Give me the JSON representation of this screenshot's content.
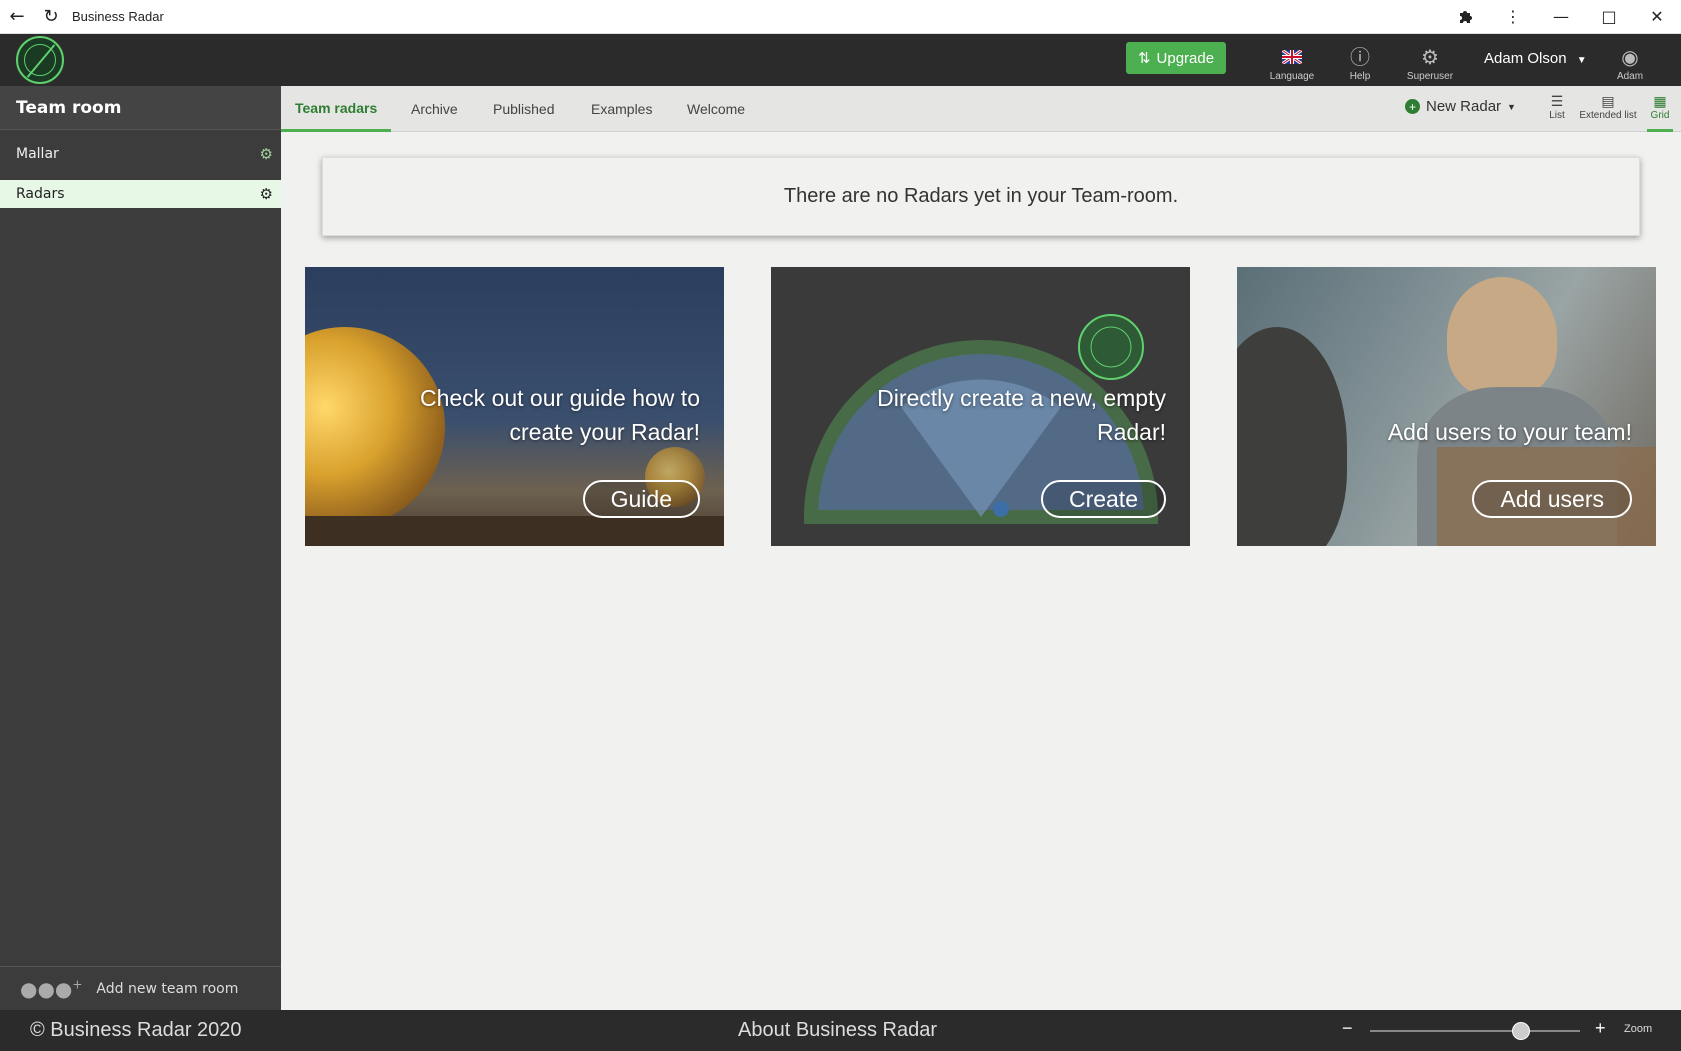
{
  "window": {
    "title": "Business Radar"
  },
  "header": {
    "upgrade_label": "Upgrade",
    "language_label": "Language",
    "help_label": "Help",
    "superuser_label": "Superuser",
    "user_name": "Adam Olson",
    "user_short": "Adam"
  },
  "sidebar": {
    "title": "Team room",
    "items": [
      {
        "label": "Mallar",
        "active": false
      },
      {
        "label": "Radars",
        "active": true
      }
    ],
    "add_label": "Add new team room"
  },
  "tabs": [
    {
      "label": "Team radars",
      "active": true
    },
    {
      "label": "Archive",
      "active": false
    },
    {
      "label": "Published",
      "active": false
    },
    {
      "label": "Examples",
      "active": false
    },
    {
      "label": "Welcome",
      "active": false
    }
  ],
  "toolbar": {
    "new_radar_label": "New Radar",
    "views": [
      {
        "label": "List",
        "active": false
      },
      {
        "label": "Extended list",
        "active": false
      },
      {
        "label": "Grid",
        "active": true
      }
    ]
  },
  "main": {
    "empty_message": "There are no Radars yet in your Team-room.",
    "cards": [
      {
        "text_line1": "Check out our guide how to",
        "text_line2": "create your Radar!",
        "button": "Guide"
      },
      {
        "text_line1": "Directly create a new, empty",
        "text_line2": "Radar!",
        "button": "Create"
      },
      {
        "text_line1": "Add users to your team!",
        "button": "Add users"
      }
    ]
  },
  "footer": {
    "copyright": "© Business Radar 2020",
    "about": "About Business Radar",
    "zoom_label": "Zoom",
    "zoom_level": 0.72
  },
  "colors": {
    "accent": "#4caf50",
    "header_bg": "#2b2b2b",
    "sidebar_bg": "#3c3c3c"
  }
}
